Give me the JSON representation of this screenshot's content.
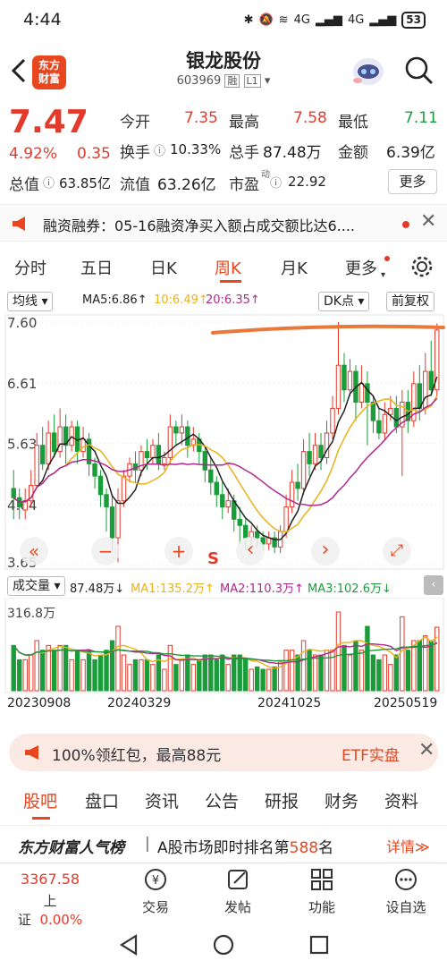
{
  "status_bar": {
    "time": "4:44",
    "signal1": "4G",
    "signal2": "4G",
    "battery": "53"
  },
  "header": {
    "title": "银龙股份",
    "code": "603969",
    "tag_rong": "融",
    "tag_l1": "L1",
    "logo_line1": "东方",
    "logo_line2": "财富"
  },
  "quote": {
    "price": "7.47",
    "change_pct": "4.92%",
    "change": "0.35",
    "open_label": "今开",
    "open": "7.35",
    "high_label": "最高",
    "high": "7.58",
    "low_label": "最低",
    "low": "7.11",
    "turnover_label": "换手",
    "turnover": "10.33%",
    "volume_label": "总手",
    "volume": "87.48万",
    "amount_label": "金额",
    "amount": "6.39亿",
    "mcap_label": "总值",
    "mcap": "63.85亿",
    "float_label": "流值",
    "float": "63.26亿",
    "pe_label": "市盈",
    "pe_sup": "动",
    "pe": "22.92",
    "more": "更多"
  },
  "notice": {
    "text": "融资融券：05-16融资净买入额占成交额比达6...."
  },
  "tabs": {
    "items": [
      "分时",
      "五日",
      "日K",
      "周K",
      "月K",
      "更多"
    ],
    "active": "周K"
  },
  "ma_line": {
    "label": "均线",
    "ma5": "MA5:6.86↑",
    "ma10": "10:6.49↑",
    "ma20": "20:6.35↑",
    "dk": "DK点",
    "fq": "前复权"
  },
  "chart_data": {
    "type": "candlestick",
    "y_ticks": [
      "7.60",
      "6.61",
      "5.63",
      "4.64",
      "3.65"
    ],
    "ylim": [
      3.65,
      7.6
    ],
    "x_ticks": [
      "20230908",
      "20240329",
      "20241025",
      "20250519"
    ],
    "last_close": 7.47,
    "candles": [
      [
        4.9,
        4.75,
        5.2,
        4.4
      ],
      [
        4.75,
        4.6,
        4.9,
        4.4
      ],
      [
        4.55,
        4.7,
        4.9,
        4.4
      ],
      [
        4.7,
        4.95,
        5.2,
        4.6
      ],
      [
        4.95,
        5.6,
        5.8,
        4.9
      ],
      [
        5.6,
        5.3,
        5.9,
        5.2
      ],
      [
        5.3,
        5.8,
        6.0,
        5.2
      ],
      [
        5.8,
        5.5,
        6.1,
        5.4
      ],
      [
        5.5,
        5.9,
        6.2,
        5.4
      ],
      [
        5.9,
        5.6,
        6.1,
        5.3
      ],
      [
        5.6,
        5.9,
        6.0,
        5.5
      ],
      [
        5.9,
        5.5,
        6.0,
        5.3
      ],
      [
        5.5,
        5.7,
        5.9,
        5.4
      ],
      [
        5.7,
        5.3,
        5.8,
        5.1
      ],
      [
        5.3,
        5.1,
        5.4,
        4.9
      ],
      [
        5.1,
        4.8,
        5.2,
        4.6
      ],
      [
        4.8,
        4.6,
        4.9,
        4.2
      ],
      [
        4.6,
        4.1,
        4.8,
        3.9
      ],
      [
        4.1,
        4.7,
        4.9,
        3.7
      ],
      [
        4.7,
        5.1,
        5.2,
        4.6
      ],
      [
        5.1,
        5.3,
        5.4,
        5.0
      ],
      [
        5.3,
        5.2,
        5.5,
        5.0
      ],
      [
        5.2,
        5.5,
        5.6,
        5.1
      ],
      [
        5.5,
        5.4,
        5.7,
        5.2
      ],
      [
        5.4,
        5.6,
        5.7,
        5.3
      ],
      [
        5.6,
        5.3,
        5.8,
        5.2
      ],
      [
        5.3,
        5.4,
        5.5,
        5.2
      ],
      [
        5.4,
        5.9,
        6.1,
        5.3
      ],
      [
        5.9,
        5.8,
        6.0,
        5.6
      ],
      [
        5.8,
        5.9,
        6.1,
        5.6
      ],
      [
        5.9,
        5.6,
        6.0,
        5.4
      ],
      [
        5.6,
        5.7,
        5.9,
        5.5
      ],
      [
        5.7,
        5.5,
        5.8,
        5.3
      ],
      [
        5.5,
        5.2,
        5.6,
        5.0
      ],
      [
        5.2,
        5.0,
        5.4,
        4.8
      ],
      [
        5.0,
        4.8,
        5.1,
        4.6
      ],
      [
        4.8,
        4.6,
        5.0,
        4.4
      ],
      [
        4.6,
        4.7,
        4.9,
        4.5
      ],
      [
        4.7,
        4.4,
        4.8,
        4.2
      ],
      [
        4.4,
        4.3,
        4.6,
        4.0
      ],
      [
        4.3,
        4.1,
        4.4,
        3.9
      ],
      [
        4.1,
        4.2,
        4.3,
        4.0
      ],
      [
        4.2,
        4.1,
        4.3,
        3.95
      ],
      [
        4.1,
        4.0,
        4.2,
        3.9
      ],
      [
        4.0,
        4.1,
        4.2,
        3.9
      ],
      [
        4.1,
        3.95,
        4.2,
        3.85
      ],
      [
        3.95,
        4.2,
        4.3,
        3.85
      ],
      [
        4.2,
        4.6,
        4.8,
        4.1
      ],
      [
        4.6,
        5.0,
        5.2,
        4.5
      ],
      [
        5.0,
        4.9,
        5.3,
        4.7
      ],
      [
        4.9,
        5.5,
        5.7,
        4.8
      ],
      [
        5.5,
        5.3,
        5.8,
        5.1
      ],
      [
        5.3,
        5.6,
        5.8,
        5.2
      ],
      [
        5.6,
        5.4,
        5.8,
        5.2
      ],
      [
        5.4,
        5.8,
        6.0,
        5.3
      ],
      [
        5.8,
        6.2,
        6.4,
        5.7
      ],
      [
        6.2,
        6.9,
        7.6,
        6.1
      ],
      [
        6.9,
        6.5,
        7.1,
        6.3
      ],
      [
        6.5,
        6.8,
        7.0,
        6.4
      ],
      [
        6.8,
        6.3,
        6.9,
        6.0
      ],
      [
        6.3,
        6.6,
        6.9,
        6.2
      ],
      [
        6.6,
        6.3,
        6.8,
        5.6
      ],
      [
        6.3,
        6.0,
        6.4,
        5.8
      ],
      [
        6.0,
        5.8,
        6.2,
        5.7
      ],
      [
        5.8,
        6.1,
        6.3,
        5.7
      ],
      [
        6.1,
        6.2,
        6.4,
        6.0
      ],
      [
        6.2,
        5.9,
        6.4,
        5.8
      ],
      [
        5.9,
        6.3,
        6.5,
        5.1
      ],
      [
        6.3,
        6.0,
        6.5,
        5.8
      ],
      [
        6.0,
        6.6,
        6.8,
        5.9
      ],
      [
        6.6,
        6.2,
        6.9,
        6.0
      ],
      [
        6.2,
        6.8,
        7.1,
        6.1
      ],
      [
        6.8,
        6.5,
        7.3,
        6.4
      ],
      [
        6.5,
        7.47,
        7.58,
        6.4
      ]
    ],
    "ma_colors": {
      "ma5": "#222222",
      "ma10": "#e8b21a",
      "ma20": "#b0288c"
    }
  },
  "vol_line": {
    "label": "成交量",
    "vol": "87.48万↓",
    "ma1": "MA1:135.2万↑",
    "ma2": "MA2:110.3万↑",
    "ma3": "MA3:102.6万↓",
    "ytick": "316.8万"
  },
  "toolbar": {
    "zoom_out": "«",
    "minus": "−",
    "plus": "+",
    "s": "S",
    "left": "‹",
    "right": "›",
    "expand": "⤢"
  },
  "banner": {
    "text": "100%领红包，最高88元",
    "etf": "ETF实盘"
  },
  "bottom_tabs": {
    "items": [
      "股吧",
      "盘口",
      "资讯",
      "公告",
      "研报",
      "财务",
      "资料"
    ],
    "active": "股吧"
  },
  "rank": {
    "brand": "东方财富人气榜",
    "text_pre": "A股市场即时排名第",
    "rank_num": "588",
    "text_post": "名",
    "detail": "详情"
  },
  "bottom_bar": {
    "index_value": "3367.58",
    "index_name": "上证",
    "index_change": "0.00%",
    "trade": "交易",
    "post": "发帖",
    "func": "功能",
    "watch": "设自选"
  }
}
